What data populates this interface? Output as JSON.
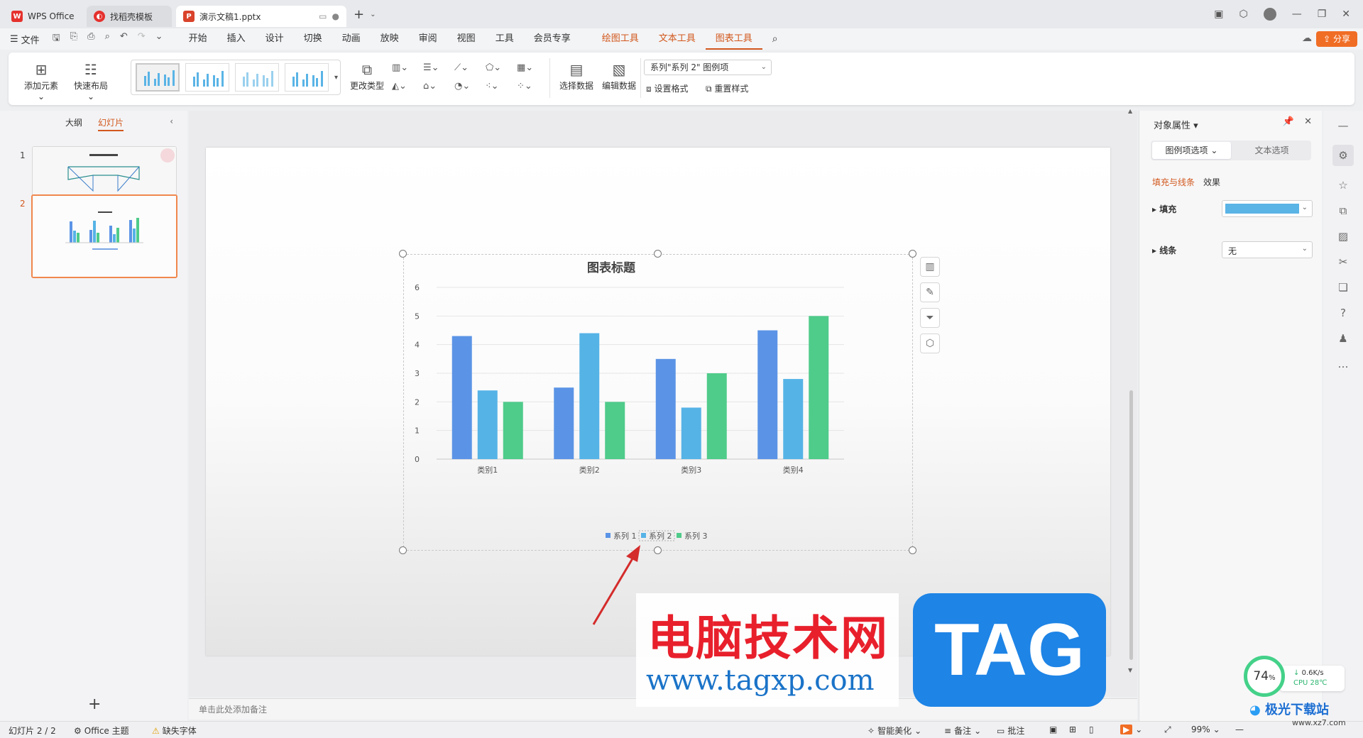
{
  "titlebar": {
    "tabs": [
      {
        "label": "WPS Office"
      },
      {
        "label": "找稻壳模板"
      },
      {
        "label": "演示文稿1.pptx"
      }
    ]
  },
  "menubar": {
    "file": "文件",
    "menus": [
      "开始",
      "插入",
      "设计",
      "切换",
      "动画",
      "放映",
      "审阅",
      "视图",
      "工具",
      "会员专享"
    ],
    "context_menus": [
      "绘图工具",
      "文本工具",
      "图表工具"
    ],
    "share": "分享"
  },
  "ribbon": {
    "add_element": "添加元素",
    "quick_layout": "快速布局",
    "change_type": "更改类型",
    "select_data": "选择数据",
    "edit_data": "编辑数据",
    "element_selector": "系列\"系列 2\" 图例项",
    "set_format": "设置格式",
    "reset_style": "重置样式"
  },
  "left_panel": {
    "tab_outline": "大纲",
    "tab_slides": "幻灯片",
    "slide_numbers": [
      "1",
      "2"
    ]
  },
  "notes": {
    "placeholder": "单击此处添加备注"
  },
  "chart_data": {
    "type": "bar",
    "title": "图表标题",
    "categories": [
      "类别1",
      "类别2",
      "类别3",
      "类别4"
    ],
    "series": [
      {
        "name": "系列 1",
        "values": [
          4.3,
          2.5,
          3.5,
          4.5
        ],
        "color": "#5b94e6"
      },
      {
        "name": "系列 2",
        "values": [
          2.4,
          4.4,
          1.8,
          2.8
        ],
        "color": "#56b3e6"
      },
      {
        "name": "系列 3",
        "values": [
          2.0,
          2.0,
          3.0,
          5.0
        ],
        "color": "#4fcb8a"
      }
    ],
    "ylim": [
      0,
      6
    ],
    "yticks": [
      "0",
      "1",
      "2",
      "3",
      "4",
      "5",
      "6"
    ],
    "grid": true,
    "legend": "bottom"
  },
  "right_panel": {
    "title": "对象属性",
    "tab_legend": "图例项选项",
    "tab_text": "文本选项",
    "sub_fill_line": "填充与线条",
    "sub_effect": "效果",
    "fill_label": "填充",
    "fill_color": "#5ab4e6",
    "line_label": "线条",
    "line_value": "无"
  },
  "statusbar": {
    "slide_info": "幻灯片 2 / 2",
    "theme": "Office 主题",
    "missing_font": "缺失字体",
    "smart_beautify": "智能美化",
    "notes": "备注",
    "comments": "批注",
    "zoom": "99%"
  },
  "watermark": {
    "site_cn": "电脑技术网",
    "site_url": "www.tagxp.com",
    "tag": "TAG",
    "perf_percent": "74",
    "perf_speed": "0.6K/s",
    "perf_cpu": "CPU 28℃",
    "logo_cn": "极光下载站",
    "logo_url": "www.xz7.com"
  }
}
